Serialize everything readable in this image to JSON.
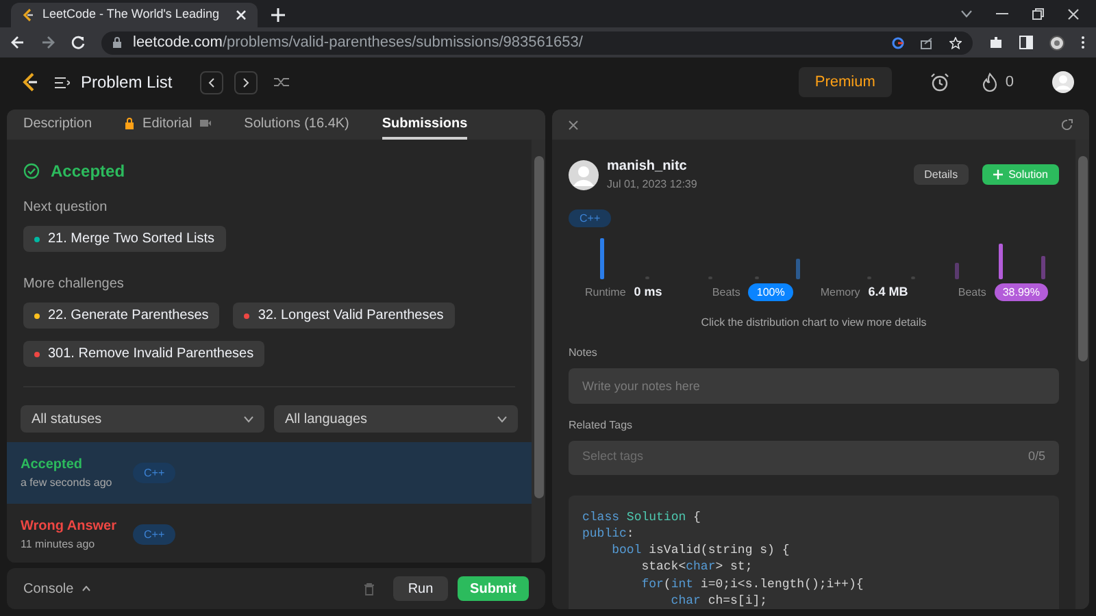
{
  "browser": {
    "tab_title": "LeetCode - The World's Leading",
    "url_host": "leetcode.com",
    "url_path": "/problems/valid-parentheses/submissions/983561653/"
  },
  "nav": {
    "title": "Problem List",
    "premium": "Premium",
    "streak": "0"
  },
  "tabs": [
    {
      "label": "Description",
      "selected": false,
      "kind": "plain"
    },
    {
      "label": "Editorial",
      "selected": false,
      "kind": "locked"
    },
    {
      "label": "Solutions (16.4K)",
      "selected": false,
      "kind": "plain"
    },
    {
      "label": "Submissions",
      "selected": true,
      "kind": "plain"
    }
  ],
  "result": {
    "status": "Accepted",
    "next_label": "Next question",
    "next": [
      {
        "label": "21. Merge Two Sorted Lists",
        "color": "#00b8a3"
      }
    ],
    "more_label": "More challenges",
    "more": [
      {
        "label": "22. Generate Parentheses",
        "color": "#ffc01e"
      },
      {
        "label": "32. Longest Valid Parentheses",
        "color": "#ef4743"
      },
      {
        "label": "301. Remove Invalid Parentheses",
        "color": "#ef4743"
      }
    ]
  },
  "filters": [
    "All statuses",
    "All languages"
  ],
  "submissions": [
    {
      "status": "Accepted",
      "kind": "accepted",
      "time": "a few seconds ago",
      "language": "C++",
      "selected": true
    },
    {
      "status": "Wrong Answer",
      "kind": "wrong",
      "time": "11 minutes ago",
      "language": "C++",
      "selected": false
    }
  ],
  "console": {
    "label": "Console",
    "run": "Run",
    "submit": "Submit"
  },
  "detail": {
    "author": "manish_nitc",
    "date": "Jul 01, 2023 12:39",
    "details_button": "Details",
    "solution_button": "Solution",
    "language": "C++",
    "runtime_label": "Runtime",
    "runtime": "0 ms",
    "runtime_beats_label": "Beats",
    "runtime_beats": "100%",
    "memory_label": "Memory",
    "memory": "6.4 MB",
    "memory_beats_label": "Beats",
    "memory_beats": "38.99%",
    "hint": "Click the distribution chart to view more details",
    "notes_label": "Notes",
    "notes_placeholder": "Write your notes here",
    "tags_label": "Related Tags",
    "tags_placeholder": "Select tags",
    "tags_count": "0/5",
    "code": [
      [
        {
          "text": "class",
          "kind": "keyword"
        },
        {
          "text": " Solution",
          "kind": "type"
        },
        {
          "text": " {",
          "kind": "plain"
        }
      ],
      [
        {
          "text": "public",
          "kind": "keyword"
        },
        {
          "text": ":",
          "kind": "plain"
        }
      ],
      [
        {
          "text": "    bool",
          "kind": "keyword"
        },
        {
          "text": " isValid(string s) {",
          "kind": "plain"
        }
      ],
      [
        {
          "text": "        stack<",
          "kind": "plain"
        },
        {
          "text": "char",
          "kind": "keyword"
        },
        {
          "text": "> st;",
          "kind": "plain"
        }
      ],
      [
        {
          "text": "        for",
          "kind": "keyword"
        },
        {
          "text": "(",
          "kind": "plain"
        },
        {
          "text": "int",
          "kind": "keyword"
        },
        {
          "text": " i=0;i<s.length();i++){",
          "kind": "plain"
        }
      ],
      [
        {
          "text": "            char",
          "kind": "keyword"
        },
        {
          "text": " ch=s[i];",
          "kind": "plain"
        }
      ]
    ]
  }
}
